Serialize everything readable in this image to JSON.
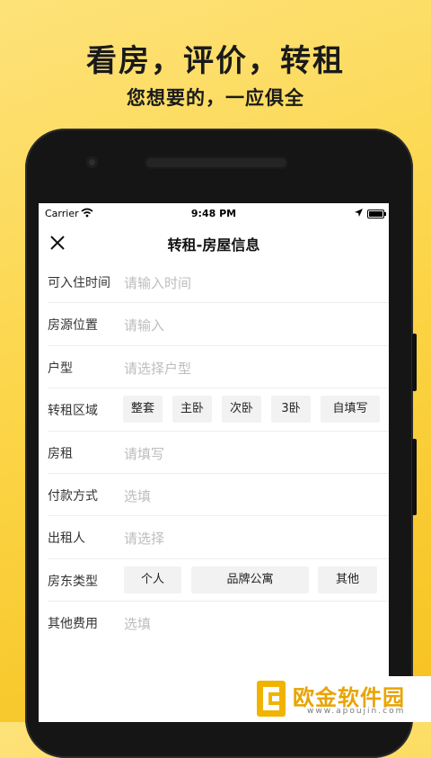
{
  "promo": {
    "title": "看房，评价，转租",
    "subtitle": "您想要的，一应俱全"
  },
  "status_bar": {
    "carrier": "Carrier",
    "time": "9:48 PM"
  },
  "nav": {
    "title": "转租-房屋信息"
  },
  "form": {
    "move_in_time": {
      "label": "可入住时间",
      "placeholder": "请输入时间"
    },
    "location": {
      "label": "房源位置",
      "placeholder": "请输入"
    },
    "layout": {
      "label": "户型",
      "placeholder": "请选择户型"
    },
    "sublet_area": {
      "label": "转租区域",
      "options": [
        "整套",
        "主卧",
        "次卧",
        "3卧",
        "自填写"
      ]
    },
    "rent": {
      "label": "房租",
      "placeholder": "请填写"
    },
    "payment": {
      "label": "付款方式",
      "placeholder": "选填"
    },
    "lessor": {
      "label": "出租人",
      "placeholder": "请选择"
    },
    "landlord_type": {
      "label": "房东类型",
      "options": [
        "个人",
        "品牌公寓",
        "其他"
      ]
    },
    "other_fees": {
      "label": "其他费用",
      "placeholder": "选填"
    }
  },
  "watermark": {
    "name": "欧金软件园",
    "url": "www.apoujin.com"
  },
  "colors": {
    "background_yellow": "#fcd64a",
    "chip_bg": "#f2f2f2",
    "placeholder": "#bdbdbd",
    "watermark": "#e8a400"
  }
}
